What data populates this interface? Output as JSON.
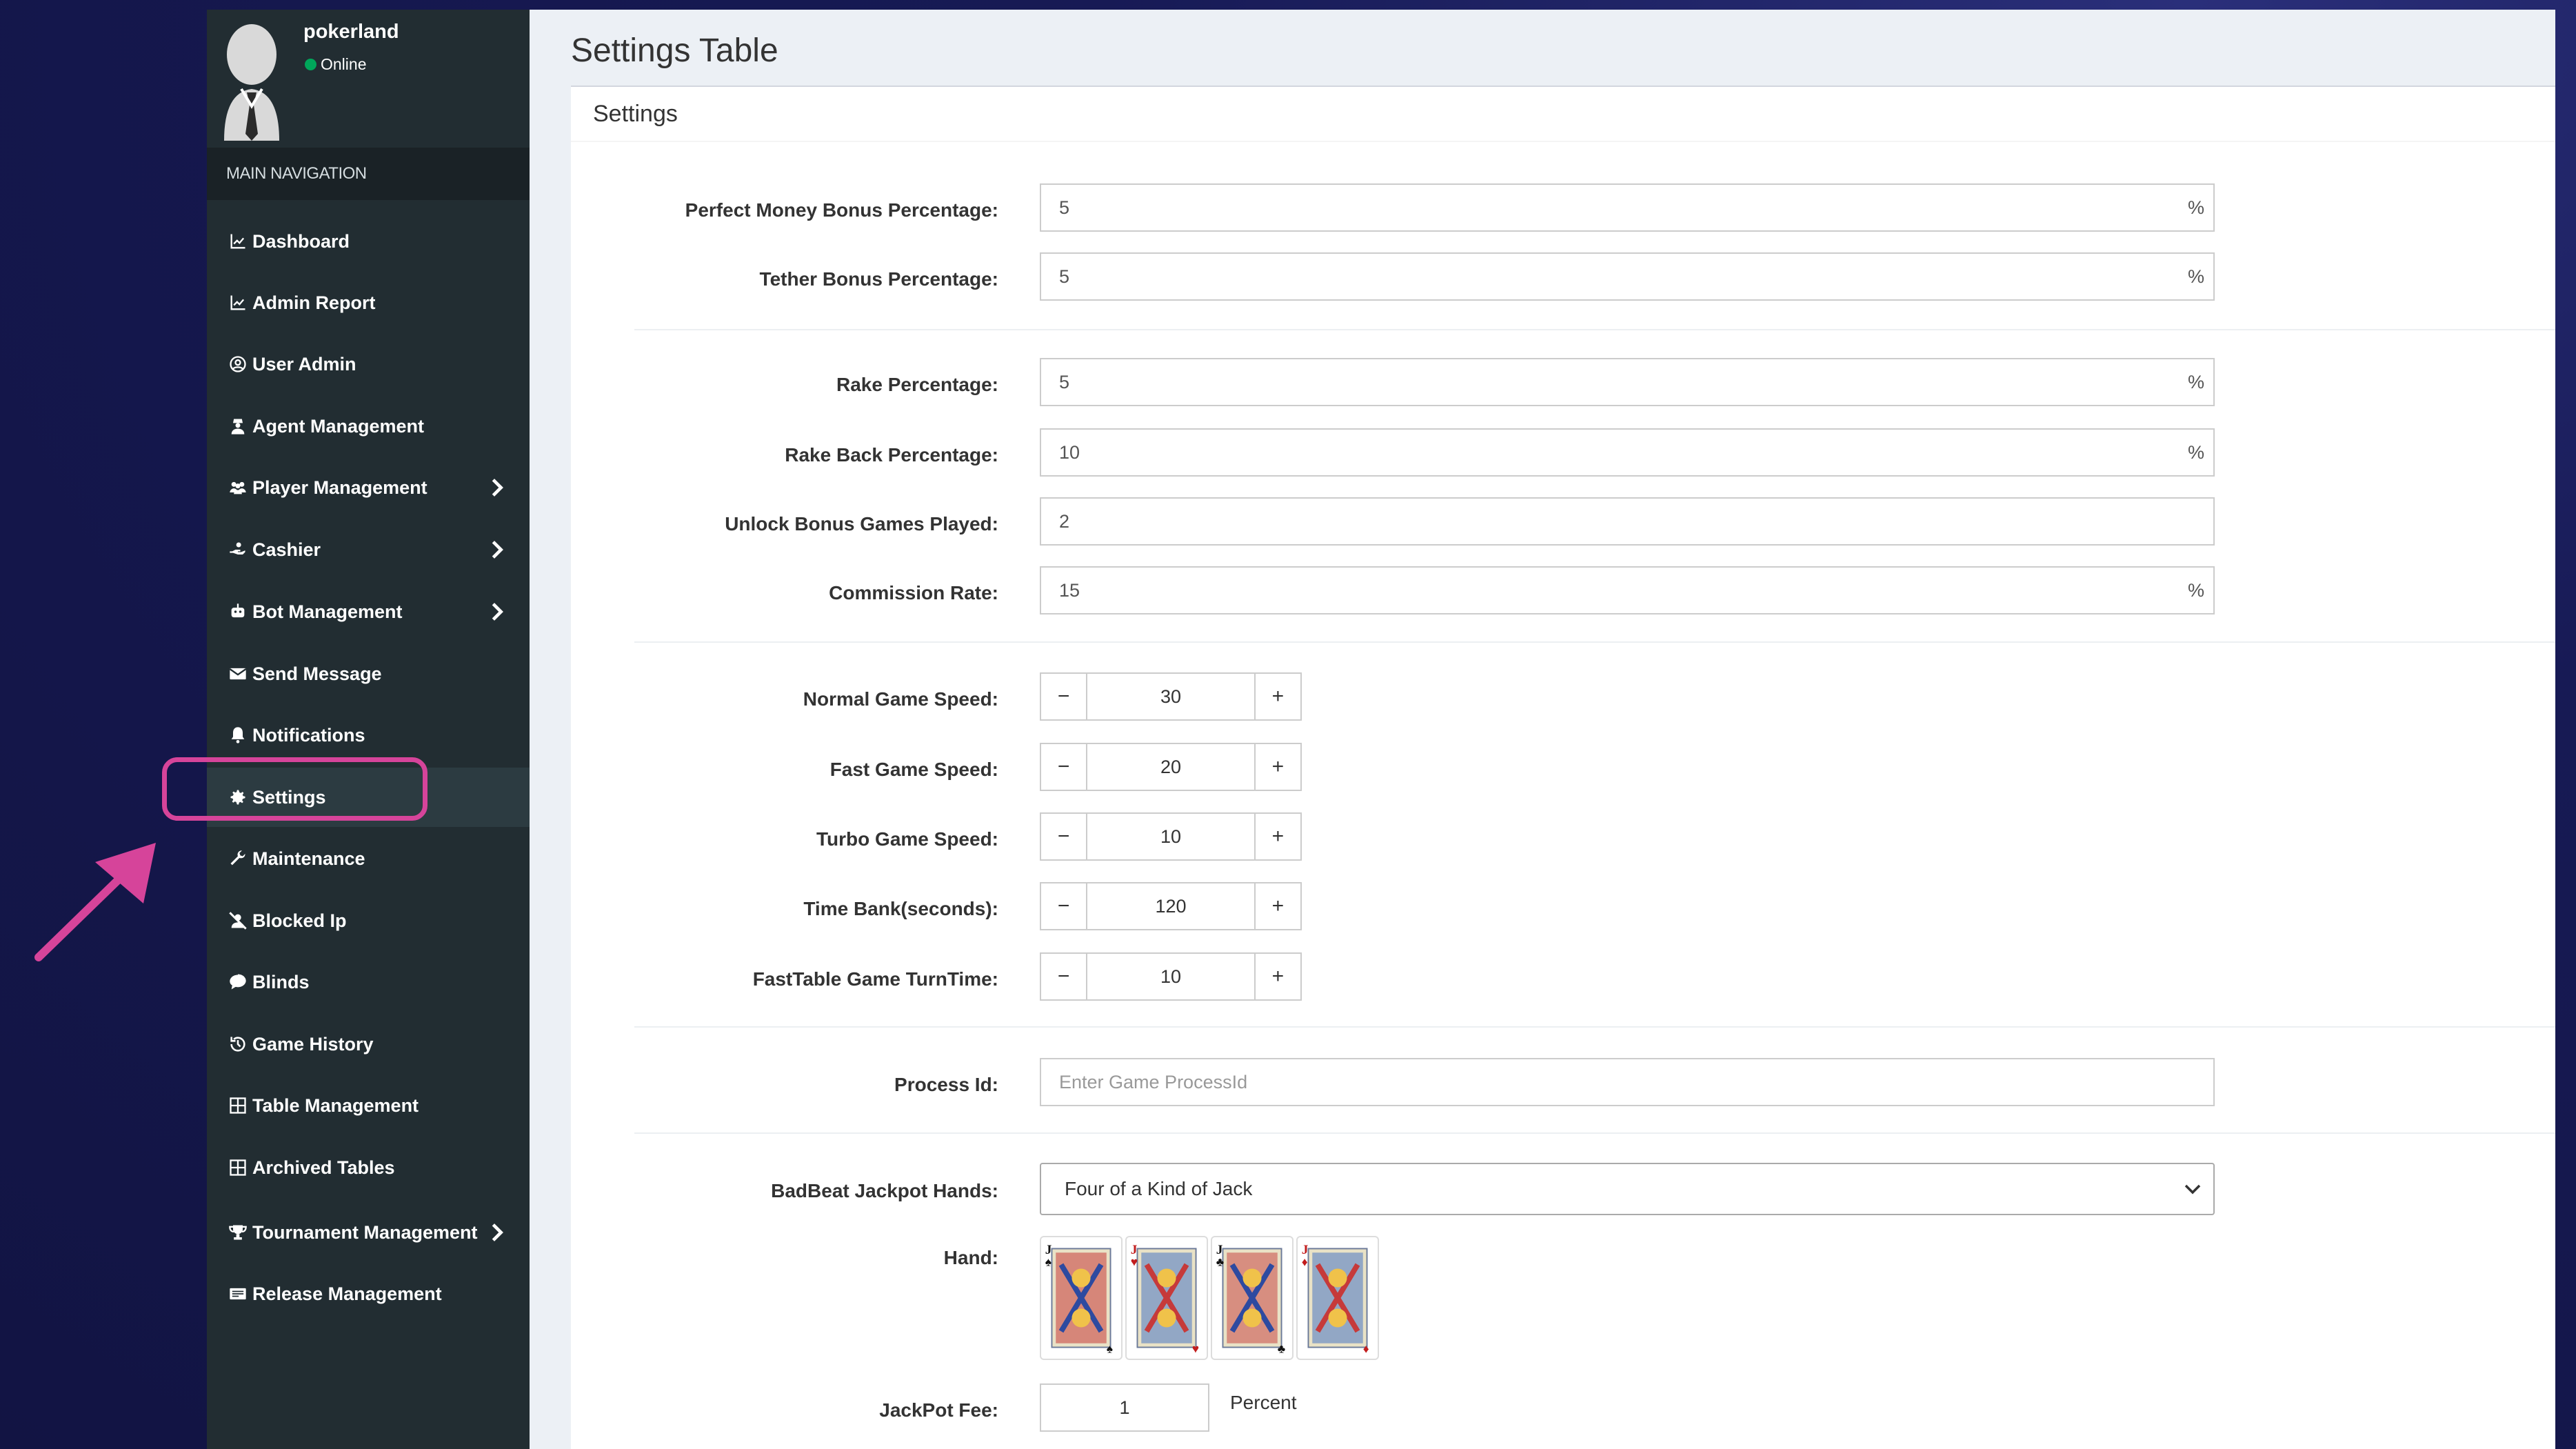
{
  "user": {
    "name": "pokerland",
    "status": "Online"
  },
  "nav": {
    "header": "MAIN NAVIGATION",
    "items": [
      {
        "label": "Dashboard",
        "icon": "chart-line-icon"
      },
      {
        "label": "Admin Report",
        "icon": "chart-line-icon"
      },
      {
        "label": "User Admin",
        "icon": "user-circle-icon"
      },
      {
        "label": "Agent Management",
        "icon": "user-secret-icon"
      },
      {
        "label": "Player Management",
        "icon": "users-icon",
        "submenu": true
      },
      {
        "label": "Cashier",
        "icon": "hand-holding-icon",
        "submenu": true
      },
      {
        "label": "Bot Management",
        "icon": "robot-icon",
        "submenu": true
      },
      {
        "label": "Send Message",
        "icon": "envelope-icon"
      },
      {
        "label": "Notifications",
        "icon": "bell-icon"
      },
      {
        "label": "Settings",
        "icon": "gear-icon",
        "active": true
      },
      {
        "label": "Maintenance",
        "icon": "wrench-icon"
      },
      {
        "label": "Blocked Ip",
        "icon": "user-slash-icon"
      },
      {
        "label": "Blinds",
        "icon": "comment-dollar-icon"
      },
      {
        "label": "Game History",
        "icon": "history-icon"
      },
      {
        "label": "Table Management",
        "icon": "table-icon"
      },
      {
        "label": "Archived Tables",
        "icon": "table-icon"
      },
      {
        "label": "Tournament Management",
        "icon": "trophy-icon",
        "submenu": true
      },
      {
        "label": "Release Management",
        "icon": "id-card-icon"
      }
    ]
  },
  "page": {
    "title": "Settings Table",
    "box_title": "Settings"
  },
  "form": {
    "perfect_money": {
      "label": "Perfect Money Bonus Percentage:",
      "value": "5",
      "unit": "%"
    },
    "tether": {
      "label": "Tether Bonus Percentage:",
      "value": "5",
      "unit": "%"
    },
    "rake": {
      "label": "Rake Percentage:",
      "value": "5",
      "unit": "%"
    },
    "rake_back": {
      "label": "Rake Back Percentage:",
      "value": "10",
      "unit": "%"
    },
    "unlock_bonus": {
      "label": "Unlock Bonus Games Played:",
      "value": "2"
    },
    "commission": {
      "label": "Commission Rate:",
      "value": "15",
      "unit": "%"
    },
    "normal_speed": {
      "label": "Normal Game Speed:",
      "value": "30"
    },
    "fast_speed": {
      "label": "Fast Game Speed:",
      "value": "20"
    },
    "turbo_speed": {
      "label": "Turbo Game Speed:",
      "value": "10"
    },
    "time_bank": {
      "label": "Time Bank(seconds):",
      "value": "120"
    },
    "fasttable_turn": {
      "label": "FastTable Game TurnTime:",
      "value": "10"
    },
    "process_id": {
      "label": "Process Id:",
      "placeholder": "Enter Game ProcessId"
    },
    "badbeat": {
      "label": "BadBeat Jackpot Hands:",
      "value": "Four of a Kind of Jack"
    },
    "hand": {
      "label": "Hand:",
      "cards": [
        "jack-of-spades",
        "jack-of-hearts",
        "jack-of-clubs",
        "jack-of-diamonds"
      ]
    },
    "jackpot_fee": {
      "label": "JackPot Fee:",
      "value": "1",
      "unit": "Percent"
    },
    "stepper": {
      "minus": "−",
      "plus": "+"
    }
  },
  "colors": {
    "sidebar": "#222d32",
    "highlight": "#d6449a",
    "online": "#00a65a"
  }
}
